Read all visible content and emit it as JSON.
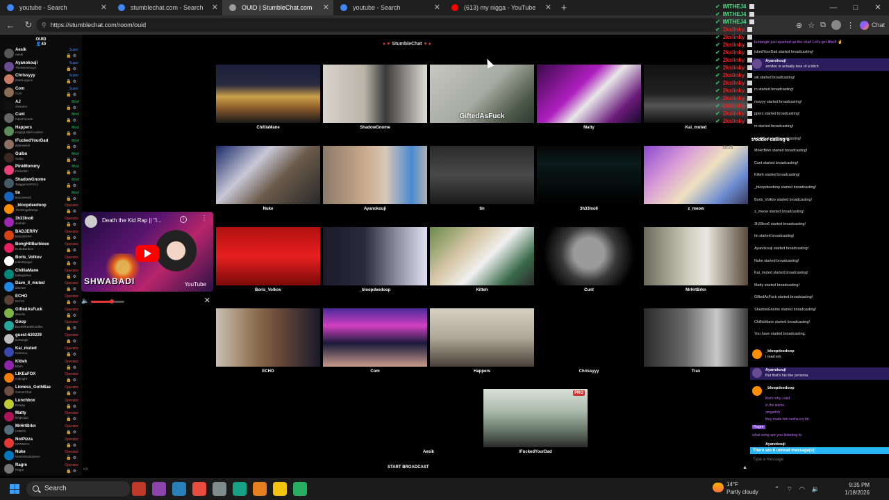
{
  "browser": {
    "tabs": [
      {
        "label": "youtube - Search",
        "active": false,
        "icon": "search-icon",
        "color": "#4285f4"
      },
      {
        "label": "stumblechat.com - Search",
        "active": false,
        "icon": "search-icon",
        "color": "#4285f4"
      },
      {
        "label": "OUID | StumbleChat.com",
        "active": true,
        "icon": "stumblechat-icon",
        "color": "#9e9e9e"
      },
      {
        "label": "youtube - Search",
        "active": false,
        "icon": "search-icon",
        "color": "#4285f4"
      },
      {
        "label": "(613) my nigga - YouTube",
        "active": false,
        "icon": "youtube-icon",
        "color": "#ff0000"
      }
    ],
    "url": "https://stumblechat.com/room/ouid",
    "chat_button": "Chat"
  },
  "room": {
    "name": "OUID",
    "count": "40"
  },
  "users": [
    {
      "name": "Aesik",
      "sub": "Aesik",
      "badge": "Super",
      "badge_color": "#3b82f6",
      "avatar_color": "#555"
    },
    {
      "name": "Ayanokouji",
      "sub": "TheWorstGuys",
      "badge": "Super",
      "badge_color": "#3b82f6",
      "avatar_color": "#6a4c93"
    },
    {
      "name": "Chrissyyy",
      "sub": "DaeSurgeon",
      "badge": "Super",
      "badge_color": "#3b82f6",
      "avatar_color": "#c97b63"
    },
    {
      "name": "Com",
      "sub": "Com",
      "badge": "Super",
      "badge_color": "#3b82f6",
      "avatar_color": "#8a6d55"
    },
    {
      "name": "AJ",
      "sub": "ImNotAJ",
      "badge": "Mod",
      "badge_color": "#22c55e",
      "avatar_color": "#111"
    },
    {
      "name": "Cunt",
      "sub": "FakeFriends",
      "badge": "Mod",
      "badge_color": "#22c55e",
      "avatar_color": "#666"
    },
    {
      "name": "Happers",
      "sub": "HappyLittleAccident",
      "badge": "Mod",
      "badge_color": "#22c55e",
      "avatar_color": "#5b8c5a"
    },
    {
      "name": "IFuckedYourDad",
      "sub": "dykeswest",
      "badge": "Mod",
      "badge_color": "#22c55e",
      "avatar_color": "#8d6e63"
    },
    {
      "name": "Ouibo",
      "sub": "Ouibo",
      "badge": "Mod",
      "badge_color": "#22c55e",
      "avatar_color": "#3e2723"
    },
    {
      "name": "PinkMommy",
      "sub": "Pinkerbin",
      "badge": "Mod",
      "badge_color": "#22c55e",
      "avatar_color": "#ec407a"
    },
    {
      "name": "ShadowGnome",
      "sub": "TwiggeromPizza",
      "badge": "Mod",
      "badge_color": "#22c55e",
      "avatar_color": "#455a64"
    },
    {
      "name": "tin",
      "sub": "timcontest5",
      "badge": "Mod",
      "badge_color": "#22c55e",
      "avatar_color": "#1565c0"
    },
    {
      "name": "_bloopdeedoop",
      "sub": "TheGingahNinja",
      "badge": "Operator",
      "badge_color": "#ef4444",
      "avatar_color": "#ff8f00"
    },
    {
      "name": "3h33lno6",
      "sub": "shelrah",
      "badge": "Operator",
      "badge_color": "#ef4444",
      "avatar_color": "#9c27b0"
    },
    {
      "name": "BADJERRY",
      "sub": "BADJERRY",
      "badge": "Operator",
      "badge_color": "#ef4444",
      "avatar_color": "#d84315"
    },
    {
      "name": "BongHitBarbieee",
      "sub": "DudeBarbiee",
      "badge": "Operator",
      "badge_color": "#ef4444",
      "avatar_color": "#e91e63"
    },
    {
      "name": "Boris_Volkov",
      "sub": "IndiaRanger",
      "badge": "Operator",
      "badge_color": "#ef4444",
      "avatar_color": "#fff"
    },
    {
      "name": "ChilliaMane",
      "sub": "ballagames",
      "badge": "Operator",
      "badge_color": "#ef4444",
      "avatar_color": "#00897b"
    },
    {
      "name": "Dave_ll_muted",
      "sub": "dave23",
      "badge": "Operator",
      "badge_color": "#ef4444",
      "avatar_color": "#1e88e5"
    },
    {
      "name": "ECHO",
      "sub": "ECHO",
      "badge": "Operator",
      "badge_color": "#ef4444",
      "avatar_color": "#5d4037"
    },
    {
      "name": "GiftedAsFuck",
      "sub": "akeelio",
      "badge": "Operator",
      "badge_color": "#ef4444",
      "avatar_color": "#7cb342"
    },
    {
      "name": "Goop",
      "sub": "BuckWheatNoodles",
      "badge": "Operator",
      "badge_color": "#ef4444",
      "avatar_color": "#26a69a"
    },
    {
      "name": "guest-620229",
      "sub": "kurtangle",
      "badge": "Operator",
      "badge_color": "#ef4444",
      "avatar_color": "#bdbdbd"
    },
    {
      "name": "Kai_muted",
      "sub": "KickeKai",
      "badge": "Operator",
      "badge_color": "#ef4444",
      "avatar_color": "#3949ab"
    },
    {
      "name": "Kitteh",
      "sub": "kitteh",
      "badge": "Operator",
      "badge_color": "#ef4444",
      "avatar_color": "#8e24aa"
    },
    {
      "name": "LIKEaFOX",
      "sub": "midnight",
      "badge": "Operator",
      "badge_color": "#ef4444",
      "avatar_color": "#f57c00"
    },
    {
      "name": "Lioness_GothBae",
      "sub": "GamerChat",
      "badge": "Operator",
      "badge_color": "#ef4444",
      "avatar_color": "#6d4c41"
    },
    {
      "name": "Lunchbox",
      "sub": "Kreepy",
      "badge": "Operator",
      "badge_color": "#ef4444",
      "avatar_color": "#c0ca33"
    },
    {
      "name": "Matty",
      "sub": "kingKapa",
      "badge": "Operator",
      "badge_color": "#ef4444",
      "avatar_color": "#ad1457"
    },
    {
      "name": "MrHrtBrkn",
      "sub": "HrtBrkn",
      "badge": "Operator",
      "badge_color": "#ef4444",
      "avatar_color": "#546e7a"
    },
    {
      "name": "NotPizza",
      "sub": "CRONICA",
      "badge": "Operator",
      "badge_color": "#ef4444",
      "avatar_color": "#e53935"
    },
    {
      "name": "Nuke",
      "sub": "NeutralSubstance",
      "badge": "Operator",
      "badge_color": "#ef4444",
      "avatar_color": "#0277bd"
    },
    {
      "name": "Ragre",
      "sub": "Ragre",
      "badge": "Operator",
      "badge_color": "#ef4444",
      "avatar_color": "#757575"
    }
  ],
  "youtube": {
    "title": "Death the Kid Rap || \"I...",
    "watermark": "SHWABADI",
    "logo": "YouTube",
    "volume": 0.62
  },
  "top_logo": "StumbleChat",
  "cameras": [
    {
      "name": "ChilliaMane",
      "bg": "linear-gradient(180deg,#1a1f3a 0%,#2a2a40 35%,#c9a24a 55%,#8a5a2a 75%,#1a1a1a 100%)"
    },
    {
      "name": "ShadowGnome",
      "bg": "linear-gradient(90deg,#d8d4cc 0%,#b9b3a8 40%,#3a3a3a 60%,#e0ddd6 100%)"
    },
    {
      "name": "",
      "overlay": "GiftedAsFuck",
      "bg": "linear-gradient(135deg,#c7c8c0 0%,#a7aaa0 50%,#4d5a4a 80%,#2e3a2e 100%)"
    },
    {
      "name": "Matty",
      "bg": "linear-gradient(135deg,#3a0a4a 0%,#b020c0 40%,#e8e8e8 55%,#6a1a7a 80%,#1a0a2a 100%)"
    },
    {
      "name": "Kai_muted",
      "bg": "linear-gradient(180deg,#111 0%,#222 50%,#555 70%,#111 100%)"
    },
    {
      "name": "Nuke",
      "bg": "linear-gradient(135deg,#1a2a6a 0%,#c8c8d8 35%,#6a5a4a 60%,#2a2a2a 100%)"
    },
    {
      "name": "Ayanokouji",
      "bg": "linear-gradient(90deg,#8a7a6a 0%,#c9a98a 40%,#d8c8b8 60%,#4a8ad0 85%,#b0b0b0 100%)"
    },
    {
      "name": "tin",
      "bg": "linear-gradient(180deg,#2a2a2a 0%,#4a4a4a 50%,#1a1a1a 100%)"
    },
    {
      "name": "3h33lno6",
      "bg": "linear-gradient(180deg,#060606 0%,#0a1a1a 30%,#000 100%)"
    },
    {
      "name": "z_meow",
      "bg": "linear-gradient(135deg,#8a4ad0 0%,#d89ad8 30%,#f0e0c0 55%,#6a8ad0 80%,#3a3a5a 100%)"
    },
    {
      "name": "Boris_Volkov",
      "bg": "linear-gradient(180deg,#b01010 0%,#e82020 50%,#7a0a0a 100%)"
    },
    {
      "name": "_bloopdeedoop",
      "bg": "linear-gradient(90deg,#1a1a2a 0%,#2a2a3a 40%,#8a8a9a 70%,#e0e0f0 100%)"
    },
    {
      "name": "Kitteh",
      "bg": "linear-gradient(135deg,#6a8a4a 0%,#d8c8a8 35%,#f0f0f0 55%,#3a6a4a 80%,#2a2a2a 100%)"
    },
    {
      "name": "Cunt",
      "bg": "radial-gradient(circle at 50% 45%,#9a9a9a 0 25%,#3a3a3a 45%,#000 75%)"
    },
    {
      "name": "MrHrtBrkn",
      "bg": "linear-gradient(90deg,#6a6a5a 0%,#c8c8b8 40%,#e8e8e0 60%,#5a4a3a 100%)"
    },
    {
      "name": "ECHO",
      "bg": "linear-gradient(90deg,#c8c0b0 0%,#8a6a4a 40%,#6a4a3a 60%,#1a1a2a 100%)"
    },
    {
      "name": "Com",
      "bg": "linear-gradient(180deg,#4a2a9a 0%,#d040c0 30%,#1a1a3a 60%,#c89a8a 100%)"
    },
    {
      "name": "Happers",
      "bg": "linear-gradient(180deg,#d8d0c0 0%,#b0a898 50%,#4a4038 100%)"
    },
    {
      "name": "Chrissyyy",
      "bg": "#000"
    },
    {
      "name": "Trax",
      "bg": "linear-gradient(90deg,#2a2a2a 0%,#6a6a6a 40%,#c8c8c8 70%,#3a3a3a 100%)"
    },
    {
      "name": "Aesik",
      "bg": "#000"
    },
    {
      "name": "IFuckedYourDad",
      "pro": "PRO",
      "bg": "linear-gradient(180deg,#d8e0d8 0%,#a8b8a8 40%,#6a7a6a 70%,#2a2a2a 100%)"
    }
  ],
  "start_broadcast": "START BROADCAST",
  "overlay_names": [
    {
      "label": "IMTHEJ4",
      "color": "#4ade80"
    },
    {
      "label": "IMTHEJ4",
      "color": "#4ade80"
    },
    {
      "label": "IMTHEJ4",
      "color": "#4ade80"
    },
    {
      "label": "2kslinky",
      "color": "#dc2626"
    },
    {
      "label": "2kslinky",
      "color": "#dc2626"
    },
    {
      "label": "2kslinky",
      "color": "#dc2626"
    },
    {
      "label": "2kslinky",
      "color": "#dc2626"
    },
    {
      "label": "2kslinky",
      "color": "#dc2626"
    },
    {
      "label": "2kslinky",
      "color": "#dc2626"
    },
    {
      "label": "2kslinky",
      "color": "#dc2626"
    },
    {
      "label": "2kslinky",
      "color": "#dc2626"
    },
    {
      "label": "2kslinky",
      "color": "#dc2626"
    },
    {
      "label": "2kslinky",
      "color": "#dc2626"
    },
    {
      "label": "2kslinky",
      "color": "#dc2626"
    },
    {
      "label": "2kslinky",
      "color": "#dc2626"
    },
    {
      "label": "2kslinky",
      "color": "#dc2626"
    }
  ],
  "overlay_extra": {
    "trodder": "trodder calling u",
    "timer": "19:25"
  },
  "chat": {
    "top_line": "kurtangle just sparked up the chat! Let's get lifted! ✌",
    "messages": [
      {
        "text": "ickedYourDad started broadcasting!"
      },
      {
        "user": "Ayanokouji",
        "text": "zenitsu is actually less of a bitch",
        "highlight": true
      },
      {
        "text": "sik started broadcasting!"
      },
      {
        "text": "rn started broadcasting!"
      },
      {
        "text": "rissyyy started broadcasting!"
      },
      {
        "text": "ppers started broadcasting!"
      },
      {
        "text": "m started broadcasting!"
      },
      {
        "text": "ECHO started broadcasting!"
      },
      {
        "text": "MrHrtBrkn started broadcasting!"
      },
      {
        "text": "Cunt started broadcasting!"
      },
      {
        "text": "Kitteh started broadcasting!"
      },
      {
        "text": "_bloopdeedoop started broadcasting!"
      },
      {
        "text": "Boris_Volkov started broadcasting!"
      },
      {
        "text": "z_meow started broadcasting!"
      },
      {
        "text": "3h33lno6 started broadcasting!"
      },
      {
        "text": "tin started broadcasting!"
      },
      {
        "text": "Ayanokouji started broadcasting!"
      },
      {
        "text": "Nuke started broadcasting!"
      },
      {
        "text": "Kai_muted started broadcasting!"
      },
      {
        "text": "Matty started broadcasting!"
      },
      {
        "text": "GiftedAsFuck started broadcasting!"
      },
      {
        "text": "ShadowGnome started broadcasting!"
      },
      {
        "text": "ChilliaMane started broadcasting!"
      },
      {
        "text": "You have started broadcasting."
      }
    ],
    "convo": [
      {
        "user": "_bloopdeedoop",
        "text": "i read em",
        "highlight": false,
        "avatar": "#ff8f00"
      },
      {
        "user": "Ayanokouji",
        "text": "But that's his like persona.",
        "highlight": true,
        "avatar": "#6a4c93"
      },
      {
        "user": "_bloopdeedoop",
        "text": "",
        "highlight": false,
        "avatar": "#ff8f00"
      }
    ],
    "bloop_lines": [
      "that's why i said",
      "in the anime",
      "omgahhh",
      "they made him sucha cry bb"
    ],
    "ragre_tag": "Ragre",
    "ragre_line": "what song are you listening to",
    "last_user": "Ayanokouji",
    "unread": "There are 8 unread message(s)!",
    "input_placeholder": "Type a message"
  },
  "taskbar": {
    "search_label": "Search",
    "apps": [
      "#c0392b",
      "#8e44ad",
      "#2980b9",
      "#e74c3c",
      "#7f8c8d",
      "#16a085",
      "#e67e22",
      "#f1c40f",
      "#27ae60"
    ],
    "weather_temp": "14°F",
    "weather_desc": "Partly cloudy",
    "time": "9:35 PM",
    "date": "1/18/2026"
  }
}
